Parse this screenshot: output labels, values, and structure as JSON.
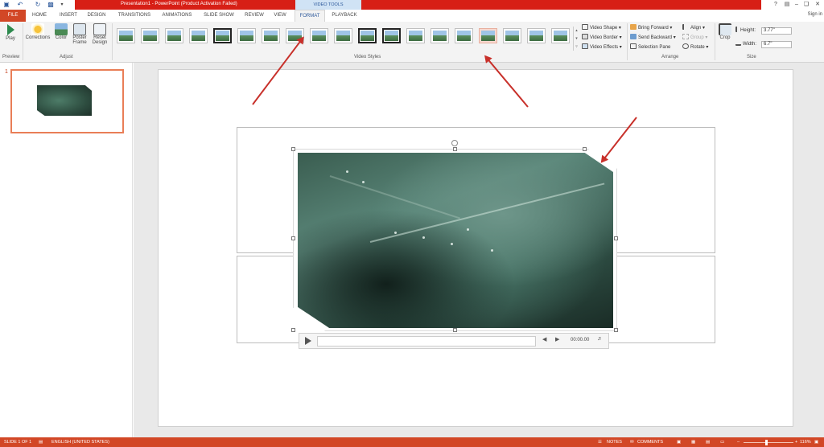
{
  "window": {
    "title": "Presentation1 -  PowerPoint (Product Activation Failed)",
    "context_tab_group": "VIDEO TOOLS",
    "sign_in": "Sign in",
    "accent_color": "#d24726"
  },
  "quick_access": [
    {
      "icon": "save-icon"
    },
    {
      "icon": "undo-icon"
    },
    {
      "icon": "redo-icon"
    },
    {
      "icon": "start-from-beginning-icon"
    }
  ],
  "tabs": [
    "FILE",
    "HOME",
    "INSERT",
    "DESIGN",
    "TRANSITIONS",
    "ANIMATIONS",
    "SLIDE SHOW",
    "REVIEW",
    "VIEW",
    "FORMAT",
    "PLAYBACK"
  ],
  "active_tab": "FORMAT",
  "ribbon": {
    "preview": {
      "play": "Play",
      "group": "Preview"
    },
    "adjust": {
      "corrections": "Corrections",
      "color": "Color",
      "poster_frame_1": "Poster",
      "poster_frame_2": "Frame",
      "reset_design_1": "Reset",
      "reset_design_2": "Design",
      "group": "Adjust"
    },
    "video_styles": {
      "group": "Video Styles",
      "selected_index": 15
    },
    "video_cmds": {
      "shape": "Video Shape",
      "border": "Video Border",
      "effects": "Video Effects"
    },
    "arrange": {
      "bring_forward": "Bring Forward",
      "send_backward": "Send Backward",
      "selection_pane": "Selection Pane",
      "align": "Align",
      "group_cmd": "Group",
      "rotate": "Rotate",
      "group": "Arrange"
    },
    "size": {
      "crop": "Crop",
      "height_label": "Height:",
      "height_value": "3.77\"",
      "width_label": "Width:",
      "width_value": "6.7\"",
      "group": "Size"
    }
  },
  "thumbnails": [
    {
      "number": "1"
    }
  ],
  "media": {
    "time": "00:00.00"
  },
  "status": {
    "slide": "SLIDE 1 OF 1",
    "language": "ENGLISH (UNITED STATES)",
    "notes": "NOTES",
    "comments": "COMMENTS",
    "zoom": "116%"
  }
}
